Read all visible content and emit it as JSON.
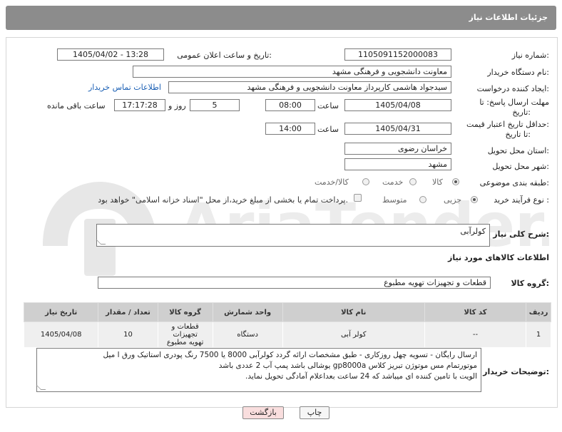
{
  "header": {
    "title": "جزئیات اطلاعات نیاز"
  },
  "watermark": {
    "text": "AriaTender.neT"
  },
  "fields": {
    "need_number": {
      "label": "شماره نیاز:",
      "value": "1105091152000083"
    },
    "announce_datetime": {
      "label": "تاریخ و ساعت اعلان عمومی:",
      "value": "1405/04/02 - 13:28"
    },
    "buyer_org": {
      "label": "نام دستگاه خریدار:",
      "value": "معاونت دانشجویی و فرهنگی مشهد"
    },
    "requester": {
      "label": "ایجاد کننده درخواست:",
      "value": "سیدجواد هاشمی کارپرداز معاونت دانشجویی و فرهنگی مشهد",
      "link": "اطلاعات تماس خریدار"
    },
    "reply_deadline": {
      "label_line1": "مهلت ارسال پاسخ: تا",
      "label_line2": "تاریخ:",
      "date": "1405/04/08",
      "time_label": "ساعت",
      "time": "08:00",
      "days": "5",
      "days_label": "روز و",
      "remaining": "17:17:28",
      "remaining_label": "ساعت باقی مانده"
    },
    "price_validity": {
      "label_line1": "حداقل تاریخ اعتبار قیمت:",
      "label_line2": "تا تاریخ:",
      "date": "1405/04/31",
      "time_label": "ساعت",
      "time": "14:00"
    },
    "province": {
      "label": "استان محل تحویل:",
      "value": "خراسان رضوی"
    },
    "city": {
      "label": "شهر محل تحویل:",
      "value": "مشهد"
    },
    "category": {
      "label": "طبقه بندی موضوعی:",
      "options": [
        "کالا",
        "خدمت",
        "کالا/خدمت"
      ],
      "selected": "کالا"
    },
    "purchase_type": {
      "label": "نوع فرآیند خرید :",
      "options": [
        "جزیی",
        "متوسط"
      ],
      "selected": "جزیی",
      "checkbox_text": "پرداخت تمام یا بخشی از مبلغ خرید،از محل \"اسناد خزانه اسلامی\" خواهد بود."
    }
  },
  "general_description": {
    "label": "شرح کلی نیاز:",
    "value": "کولرآبی"
  },
  "goods_info": {
    "title": "اطلاعات کالاهای مورد نیاز"
  },
  "goods_group": {
    "label": "گروه کالا:",
    "value": "قطعات و تجهیزات تهویه مطبوع"
  },
  "table": {
    "headers": [
      "ردیف",
      "کد کالا",
      "نام کالا",
      "واحد شمارش",
      "گروه کالا",
      "تعداد / مقدار",
      "تاریخ نیاز"
    ],
    "rows": [
      {
        "row": "1",
        "code": "--",
        "name": "کولر آبی",
        "unit": "دستگاه",
        "group_line1": "قطعات و تجهیزات",
        "group_line2": "تهویه مطبوع",
        "qty": "10",
        "date": "1405/04/08"
      }
    ]
  },
  "buyer_notes": {
    "label": "توضیحات خریدار:",
    "lines": [
      "ارسال رایگان - تسویه چهل روزکاری - طبق مشخصات ارائه گردد کولرآبی 8000 یا 7500 رنگ پودری استاتیک ورق ا میل",
      "موتورتمام مس موتوژن تبریز کلاس gp8000a یوشالی باشد پمپ آب 2 عددی باشد",
      "الویت با تامین کننده ای میباشد که 24 ساعت بعداعلام آمادگی تحویل نماید."
    ]
  },
  "buttons": {
    "print": "چاپ",
    "back": "بازگشت"
  },
  "colors": {
    "header_bg": "#8c8c8c",
    "link": "#1a5fb4",
    "back_btn_bg": "#f9dede"
  }
}
